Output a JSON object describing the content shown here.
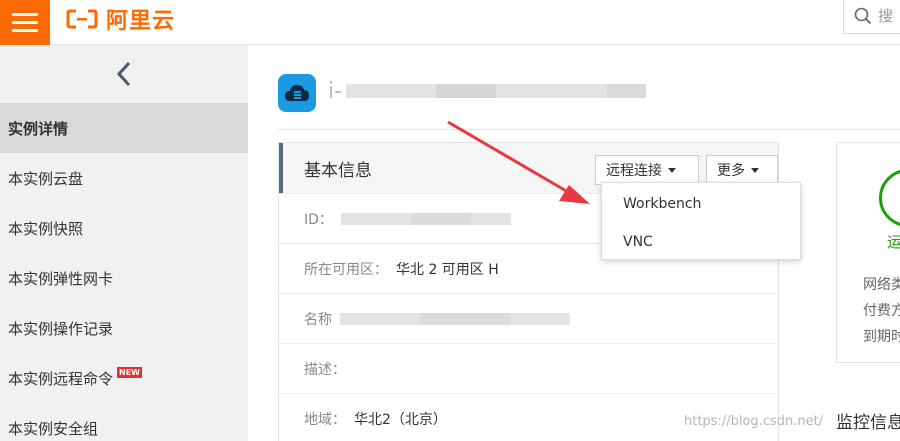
{
  "topbar": {
    "logo_text": "阿里云",
    "search_placeholder": "搜"
  },
  "sidebar": {
    "items": [
      {
        "label": "实例详情",
        "active": true
      },
      {
        "label": "本实例云盘"
      },
      {
        "label": "本实例快照"
      },
      {
        "label": "本实例弹性网卡"
      },
      {
        "label": "本实例操作记录"
      },
      {
        "label": "本实例远程命令",
        "badge": "NEW"
      },
      {
        "label": "本实例安全组"
      }
    ]
  },
  "instance": {
    "name_prefix": "i-"
  },
  "basic_info": {
    "title": "基本信息",
    "remote_connect_label": "远程连接",
    "more_label": "更多",
    "rows": [
      {
        "label": "ID：",
        "value": ""
      },
      {
        "label": "所在可用区：",
        "value": "华北 2 可用区 H"
      },
      {
        "label": "名称",
        "value": ""
      },
      {
        "label": "描述：",
        "value": ""
      },
      {
        "label": "地域：",
        "value": "华北2（北京）"
      }
    ]
  },
  "dropdown": {
    "items": [
      "Workbench",
      "VNC"
    ]
  },
  "status_card": {
    "status_text": "运",
    "lines": [
      "网络类",
      "付费方",
      "到期时"
    ]
  },
  "monitor": {
    "title": "监控信息"
  },
  "watermark": "https://blog.csdn.net/",
  "colors": {
    "brand": "#ff6a00",
    "status_green": "#1aa10a",
    "instance_icon": "#1a9ae0",
    "arrow": "#e8383d"
  },
  "icons": {
    "menu": "hamburger-icon",
    "back": "chevron-left-icon",
    "search": "search-icon",
    "instance": "cloud-server-icon"
  }
}
